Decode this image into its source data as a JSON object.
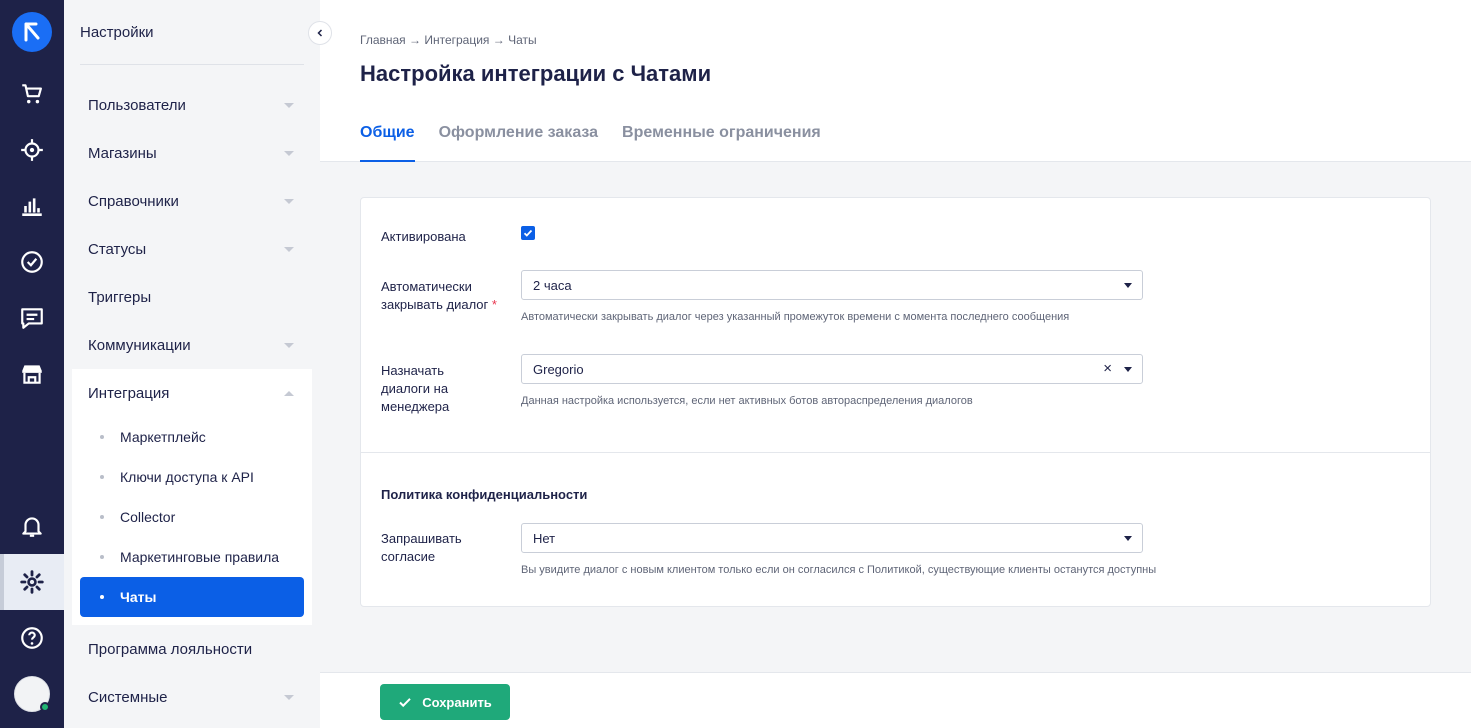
{
  "rail": {
    "icons": [
      "cart-icon",
      "target-icon",
      "analytics-icon",
      "tasks-icon",
      "chat-icon",
      "store-icon",
      "bell-icon",
      "settings-icon",
      "help-icon"
    ]
  },
  "sidebar": {
    "title": "Настройки",
    "items": [
      {
        "label": "Пользователи"
      },
      {
        "label": "Магазины"
      },
      {
        "label": "Справочники"
      },
      {
        "label": "Статусы"
      },
      {
        "label": "Триггеры"
      },
      {
        "label": "Коммуникации"
      }
    ],
    "group": {
      "label": "Интеграция",
      "subitems": [
        {
          "label": "Маркетплейс"
        },
        {
          "label": "Ключи доступа к API"
        },
        {
          "label": "Collector"
        },
        {
          "label": "Маркетинговые правила"
        },
        {
          "label": "Чаты"
        }
      ]
    },
    "bottom_items": [
      {
        "label": "Программа лояльности"
      },
      {
        "label": "Системные"
      }
    ]
  },
  "header": {
    "breadcrumb": "Главная → Интеграция → Чаты",
    "title": "Настройка интеграции с Чатами",
    "tabs": [
      {
        "label": "Общие"
      },
      {
        "label": "Оформление заказа"
      },
      {
        "label": "Временные ограничения"
      }
    ]
  },
  "form": {
    "activated_label": "Активирована",
    "activated_checked": true,
    "autoclose_label": "Автоматически закрывать диалог",
    "autoclose_required": "*",
    "autoclose_value": "2 часа",
    "autoclose_hint": "Автоматически закрывать диалог через указанный промежуток времени с момента последнего сообщения",
    "assign_label": "Назначать диалоги на менеджера",
    "assign_value": "Gregorio",
    "assign_clear": "×",
    "assign_hint": "Данная настройка используется, если нет активных ботов автораспределения диалогов",
    "privacy_title": "Политика конфиденциальности",
    "consent_label": "Запрашивать согласие",
    "consent_value": "Нет",
    "consent_hint": "Вы увидите диалог с новым клиентом только если он согласился с Политикой, существующие клиенты останутся доступны"
  },
  "footer": {
    "save_label": "Сохранить"
  },
  "colors": {
    "rail_bg": "#1e2248",
    "accent": "#0b5fe6",
    "save": "#1fa97a",
    "required": "#e8364f"
  }
}
